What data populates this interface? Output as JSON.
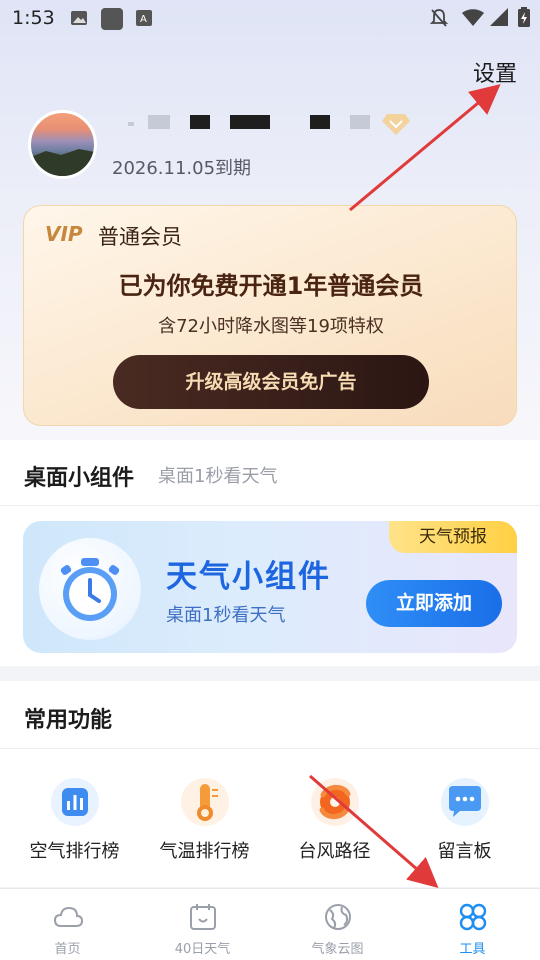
{
  "status_bar": {
    "time": "1:53",
    "icons": [
      "image-icon",
      "app-icon",
      "text-icon",
      "mute-icon",
      "wifi-icon",
      "signal-icon",
      "battery-icon"
    ]
  },
  "header": {
    "settings_label": "设置"
  },
  "profile": {
    "name_masked": true,
    "badge_icon": "diamond-badge-icon",
    "expire_text": "2026.11.05到期"
  },
  "vip_card": {
    "logo": "VIP",
    "title": "普通会员",
    "headline": "已为你免费开通1年普通会员",
    "subline": "含72小时降水图等19项特权",
    "button_label": "升级高级会员免广告"
  },
  "widget_section": {
    "title": "桌面小组件",
    "subtitle": "桌面1秒看天气",
    "banner": {
      "tag": "天气预报",
      "title": "天气小组件",
      "subtitle": "桌面1秒看天气",
      "button_label": "立即添加",
      "icon": "stopwatch-icon"
    }
  },
  "functions": {
    "title": "常用功能",
    "items": [
      {
        "label": "空气排行榜",
        "icon": "air-chart-icon"
      },
      {
        "label": "气温排行榜",
        "icon": "thermometer-icon"
      },
      {
        "label": "台风路径",
        "icon": "typhoon-icon"
      },
      {
        "label": "留言板",
        "icon": "message-board-icon"
      }
    ]
  },
  "bottom_nav": {
    "items": [
      {
        "label": "首页",
        "icon": "cloud-home-icon",
        "active": false
      },
      {
        "label": "40日天气",
        "icon": "calendar-icon",
        "active": false
      },
      {
        "label": "气象云图",
        "icon": "globe-icon",
        "active": false
      },
      {
        "label": "工具",
        "icon": "tools-grid-icon",
        "active": true
      }
    ]
  },
  "colors": {
    "accent_blue": "#1e8ef0",
    "annotation_arrow": "#e03a3a",
    "vip_button": "#2b1613",
    "vip_gold": "#c7883d"
  }
}
